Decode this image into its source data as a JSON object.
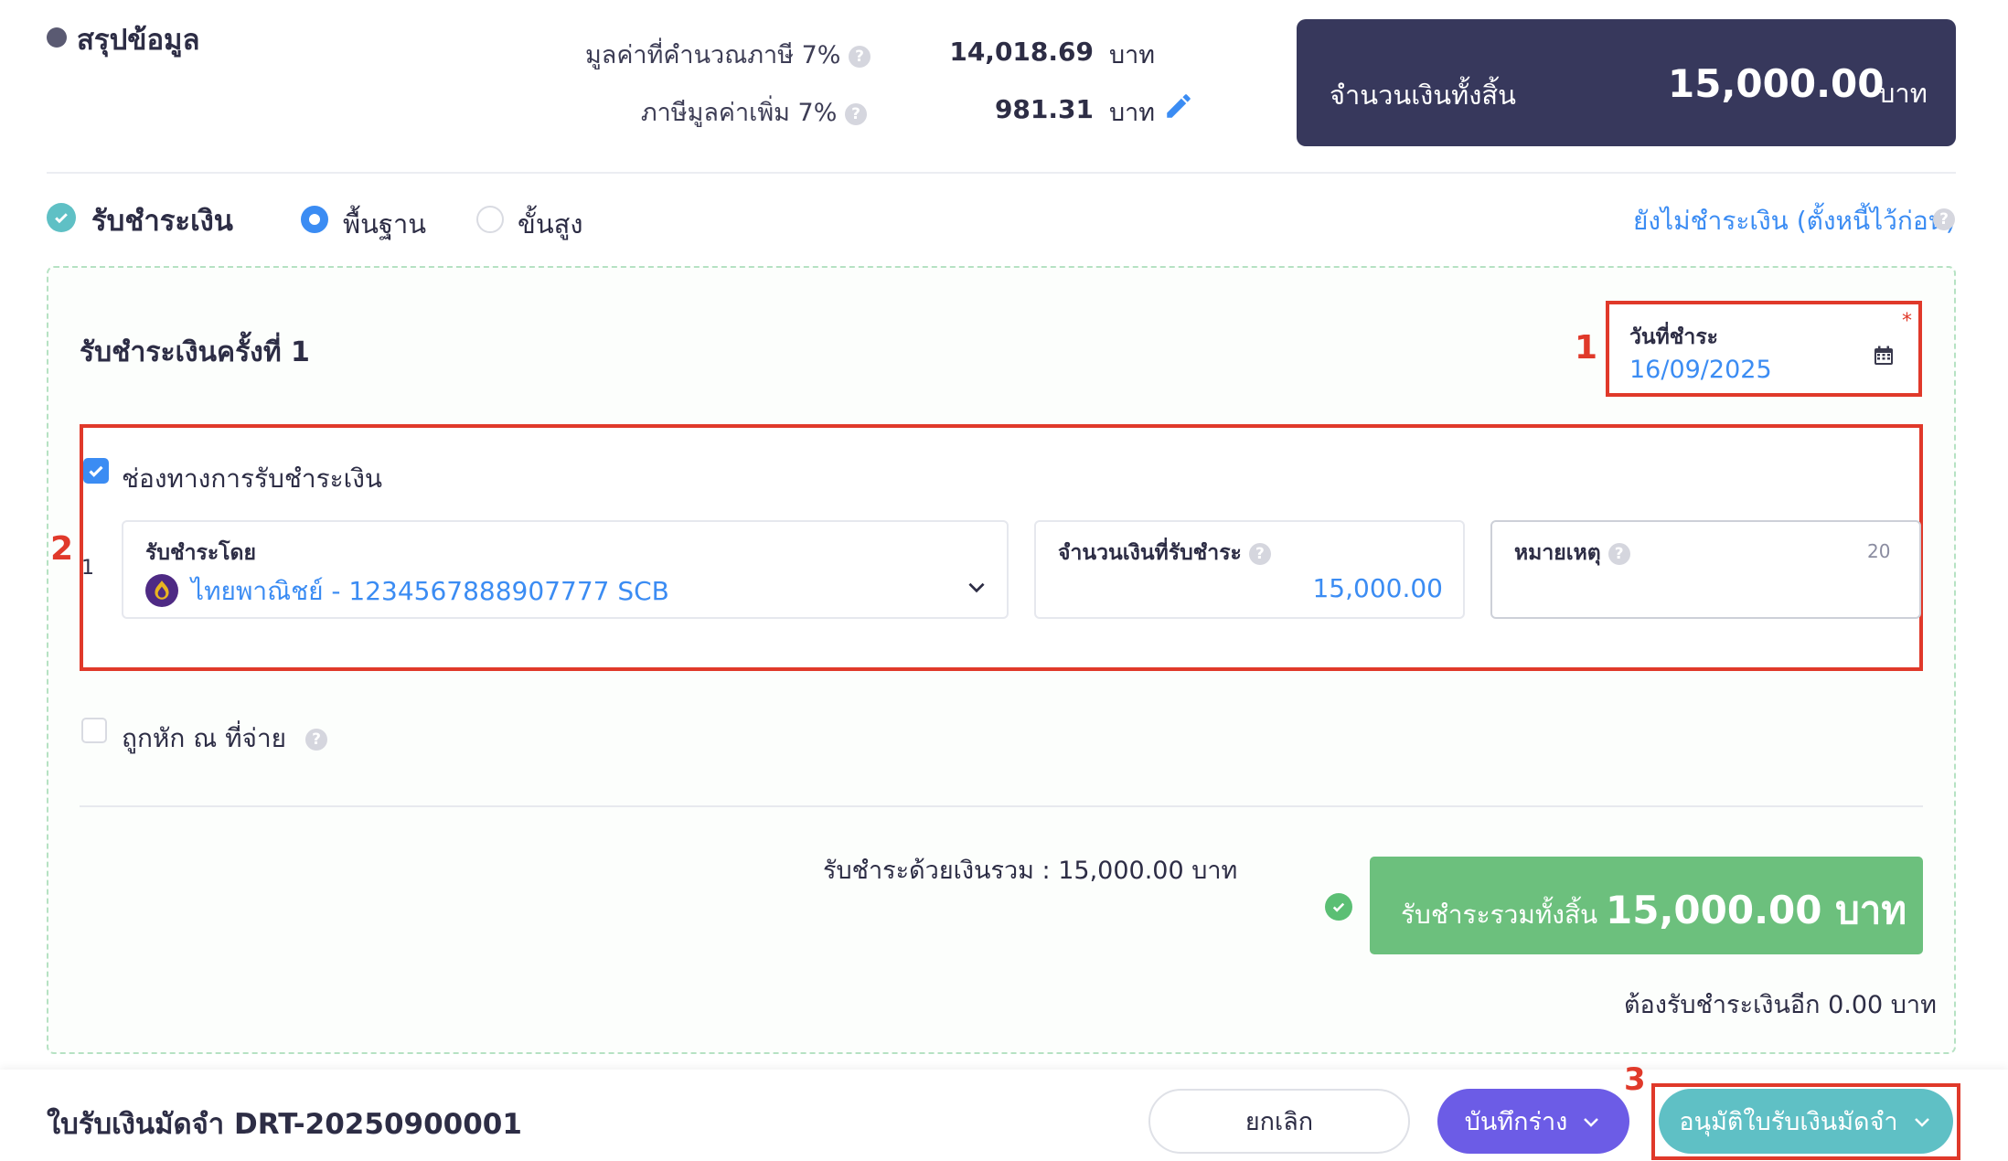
{
  "summary": {
    "title": "สรุปข้อมูล",
    "taxable_label": "มูลค่าที่คำนวณภาษี 7%",
    "taxable_value": "14,018.69",
    "vat_label": "ภาษีมูลค่าเพิ่ม 7%",
    "vat_value": "981.31",
    "unit": "บาท",
    "total_label": "จำนวนเงินทั้งสิ้น",
    "total_value": "15,000.00",
    "total_unit": "บาท",
    "help_glyph": "?"
  },
  "payment": {
    "title": "รับชำระเงิน",
    "mode_basic": "พื้นฐาน",
    "mode_advanced": "ขั้นสูง",
    "selected_mode": "basic",
    "unpaid_link": "ยังไม่ชำระเงิน (ตั้งหนี้ไว้ก่อน)"
  },
  "installment": {
    "title": "รับชำระเงินครั้งที่ 1",
    "date_label": "วันที่ชำระ",
    "date_value": "16/09/2025",
    "required_mark": "*",
    "channel_label": "ช่องทางการรับชำระเงิน",
    "channel_checked": true,
    "row_index": "1",
    "method_label": "รับชำระโดย",
    "method_value": "ไทยพาณิชย์ - 1234567888907777 SCB",
    "amount_label": "จำนวนเงินที่รับชำระ",
    "amount_value": "15,000.00",
    "note_label": "หมายเหตุ",
    "note_counter": "20",
    "note_value": "",
    "wht_label": "ถูกหัก ณ ที่จ่าย",
    "wht_checked": false,
    "cash_total": "รับชำระด้วยเงินรวม :  15,000.00 บาท",
    "grand_label": "รับชำระรวมทั้งสิ้น",
    "grand_value": "15,000.00 บาท",
    "remaining": "ต้องรับชำระเงินอีก 0.00 บาท"
  },
  "callouts": {
    "one": "1",
    "two": "2",
    "three": "3"
  },
  "footer": {
    "doc_title": "ใบรับเงินมัดจำ DRT-20250900001",
    "cancel": "ยกเลิก",
    "save_draft": "บันทึกร่าง",
    "approve": "อนุมัติใบรับเงินมัดจำ"
  },
  "colors": {
    "accent_blue": "#3b8cf3",
    "dark_navy": "#37385c",
    "green": "#6cc07d",
    "teal": "#5fc0c5",
    "purple": "#6c5ce6",
    "callout_red": "#e0392a"
  },
  "icons": [
    "help-icon",
    "pencil-icon",
    "check-circle-icon",
    "calendar-icon",
    "checkbox-check-icon",
    "bank-logo-icon",
    "chevron-down-icon"
  ]
}
